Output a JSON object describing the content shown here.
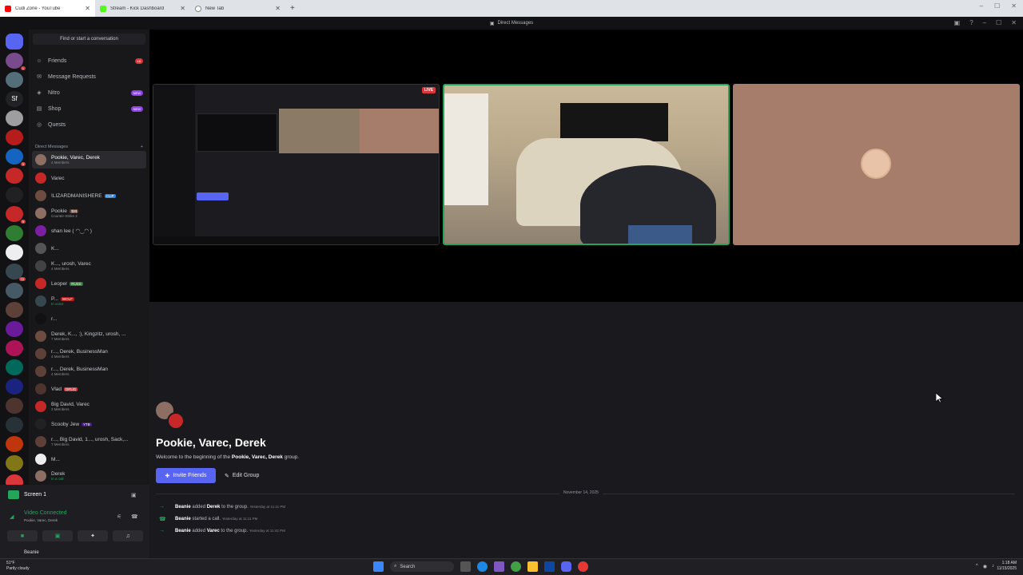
{
  "browser": {
    "tabs": [
      {
        "label": "Cudi Zone - YouTube",
        "color": "#ff0000"
      },
      {
        "label": "Stream - Kick Dashboard",
        "color": "#53fc18"
      },
      {
        "label": "New Tab",
        "color": "#888888"
      }
    ],
    "new_tab_icon": "plus-icon"
  },
  "app": {
    "title": "Direct Messages"
  },
  "sidebar": {
    "find_label": "Find or start a conversation",
    "nav": [
      {
        "label": "Friends",
        "icon": "people-icon",
        "badge": "18"
      },
      {
        "label": "Message Requests",
        "icon": "envelope-icon",
        "badge": ""
      },
      {
        "label": "Nitro",
        "icon": "nitro-icon",
        "badge": "NEW"
      },
      {
        "label": "Shop",
        "icon": "shop-icon",
        "badge": "NEW"
      },
      {
        "label": "Quests",
        "icon": "quest-icon",
        "badge": ""
      }
    ],
    "dm_header": "Direct Messages",
    "dm_add": "+",
    "dms": [
      {
        "name": "Pookie, Varec, Derek",
        "sub": "4 Members",
        "tag": ""
      },
      {
        "name": "Varec",
        "sub": "",
        "tag": ""
      },
      {
        "name": "!LIZARDMANISHERE",
        "sub": "",
        "tag": "CLIP"
      },
      {
        "name": "Pookie",
        "sub": "Counter-Strike 2",
        "tag": "$$$"
      },
      {
        "name": "shan lee ( ◠‿◠ )",
        "sub": "",
        "tag": ""
      },
      {
        "name": "K...",
        "sub": "",
        "tag": ""
      },
      {
        "name": "K..., urosh, Varec",
        "sub": "4 Members",
        "tag": ""
      },
      {
        "name": "Leoper",
        "sub": "",
        "tag": "RUSS"
      },
      {
        "name": "P...",
        "sub": "In voice",
        "tag": "WOLF"
      },
      {
        "name": "r...",
        "sub": "",
        "tag": ""
      },
      {
        "name": "Derek, K..., :), Kingzitz, urosh, ...",
        "sub": "7 Members",
        "tag": ""
      },
      {
        "name": "r..., Derek, BusinessMan",
        "sub": "4 Members",
        "tag": ""
      },
      {
        "name": "r..., Derek, BusinessMan",
        "sub": "4 Members",
        "tag": ""
      },
      {
        "name": "Vlad",
        "sub": "",
        "tag": "DRUG"
      },
      {
        "name": "Big David, Varec",
        "sub": "3 Members",
        "tag": ""
      },
      {
        "name": "Scooby Jew",
        "sub": "",
        "tag": "YTB"
      },
      {
        "name": "r..., Big David, 1..., urosh, Sack,...",
        "sub": "7 Members",
        "tag": ""
      },
      {
        "name": "M...",
        "sub": "",
        "tag": ""
      },
      {
        "name": "Derek",
        "sub": "In a call",
        "tag": ""
      }
    ]
  },
  "panel": {
    "screen_label": "Screen 1",
    "status": "Video Connected",
    "channel": "Pookie, Varec, Derek",
    "username": "Beanie"
  },
  "stage": {
    "live_label": "LIVE"
  },
  "chat": {
    "title": "Pookie, Varec, Derek",
    "welcome_pre": "Welcome to the beginning of the",
    "welcome_name": "Pookie, Varec, Derek",
    "welcome_post": "group.",
    "invite_label": "Invite Friends",
    "edit_label": "Edit Group",
    "date": "November 14, 2025",
    "events": [
      {
        "actor": "Beanie",
        "action": "added",
        "target": "Derek",
        "rest": "to the group.",
        "time": "Yesterday at 11:11 PM",
        "icon": "arrow-right-icon"
      },
      {
        "actor": "Beanie",
        "action": "started a call.",
        "target": "",
        "rest": "",
        "time": "Yesterday at 11:11 PM",
        "icon": "phone-icon"
      },
      {
        "actor": "Beanie",
        "action": "added",
        "target": "Varec",
        "rest": "to the group.",
        "time": "Yesterday at 11:42 PM",
        "icon": "arrow-right-icon"
      }
    ]
  },
  "taskbar": {
    "weather_temp": "51°F",
    "weather_desc": "Partly cloudy",
    "search_label": "Search",
    "time": "1:18 AM",
    "date": "11/15/2025"
  },
  "colors": {
    "accent": "#5865f2",
    "green": "#23a55a",
    "red": "#da373c"
  }
}
